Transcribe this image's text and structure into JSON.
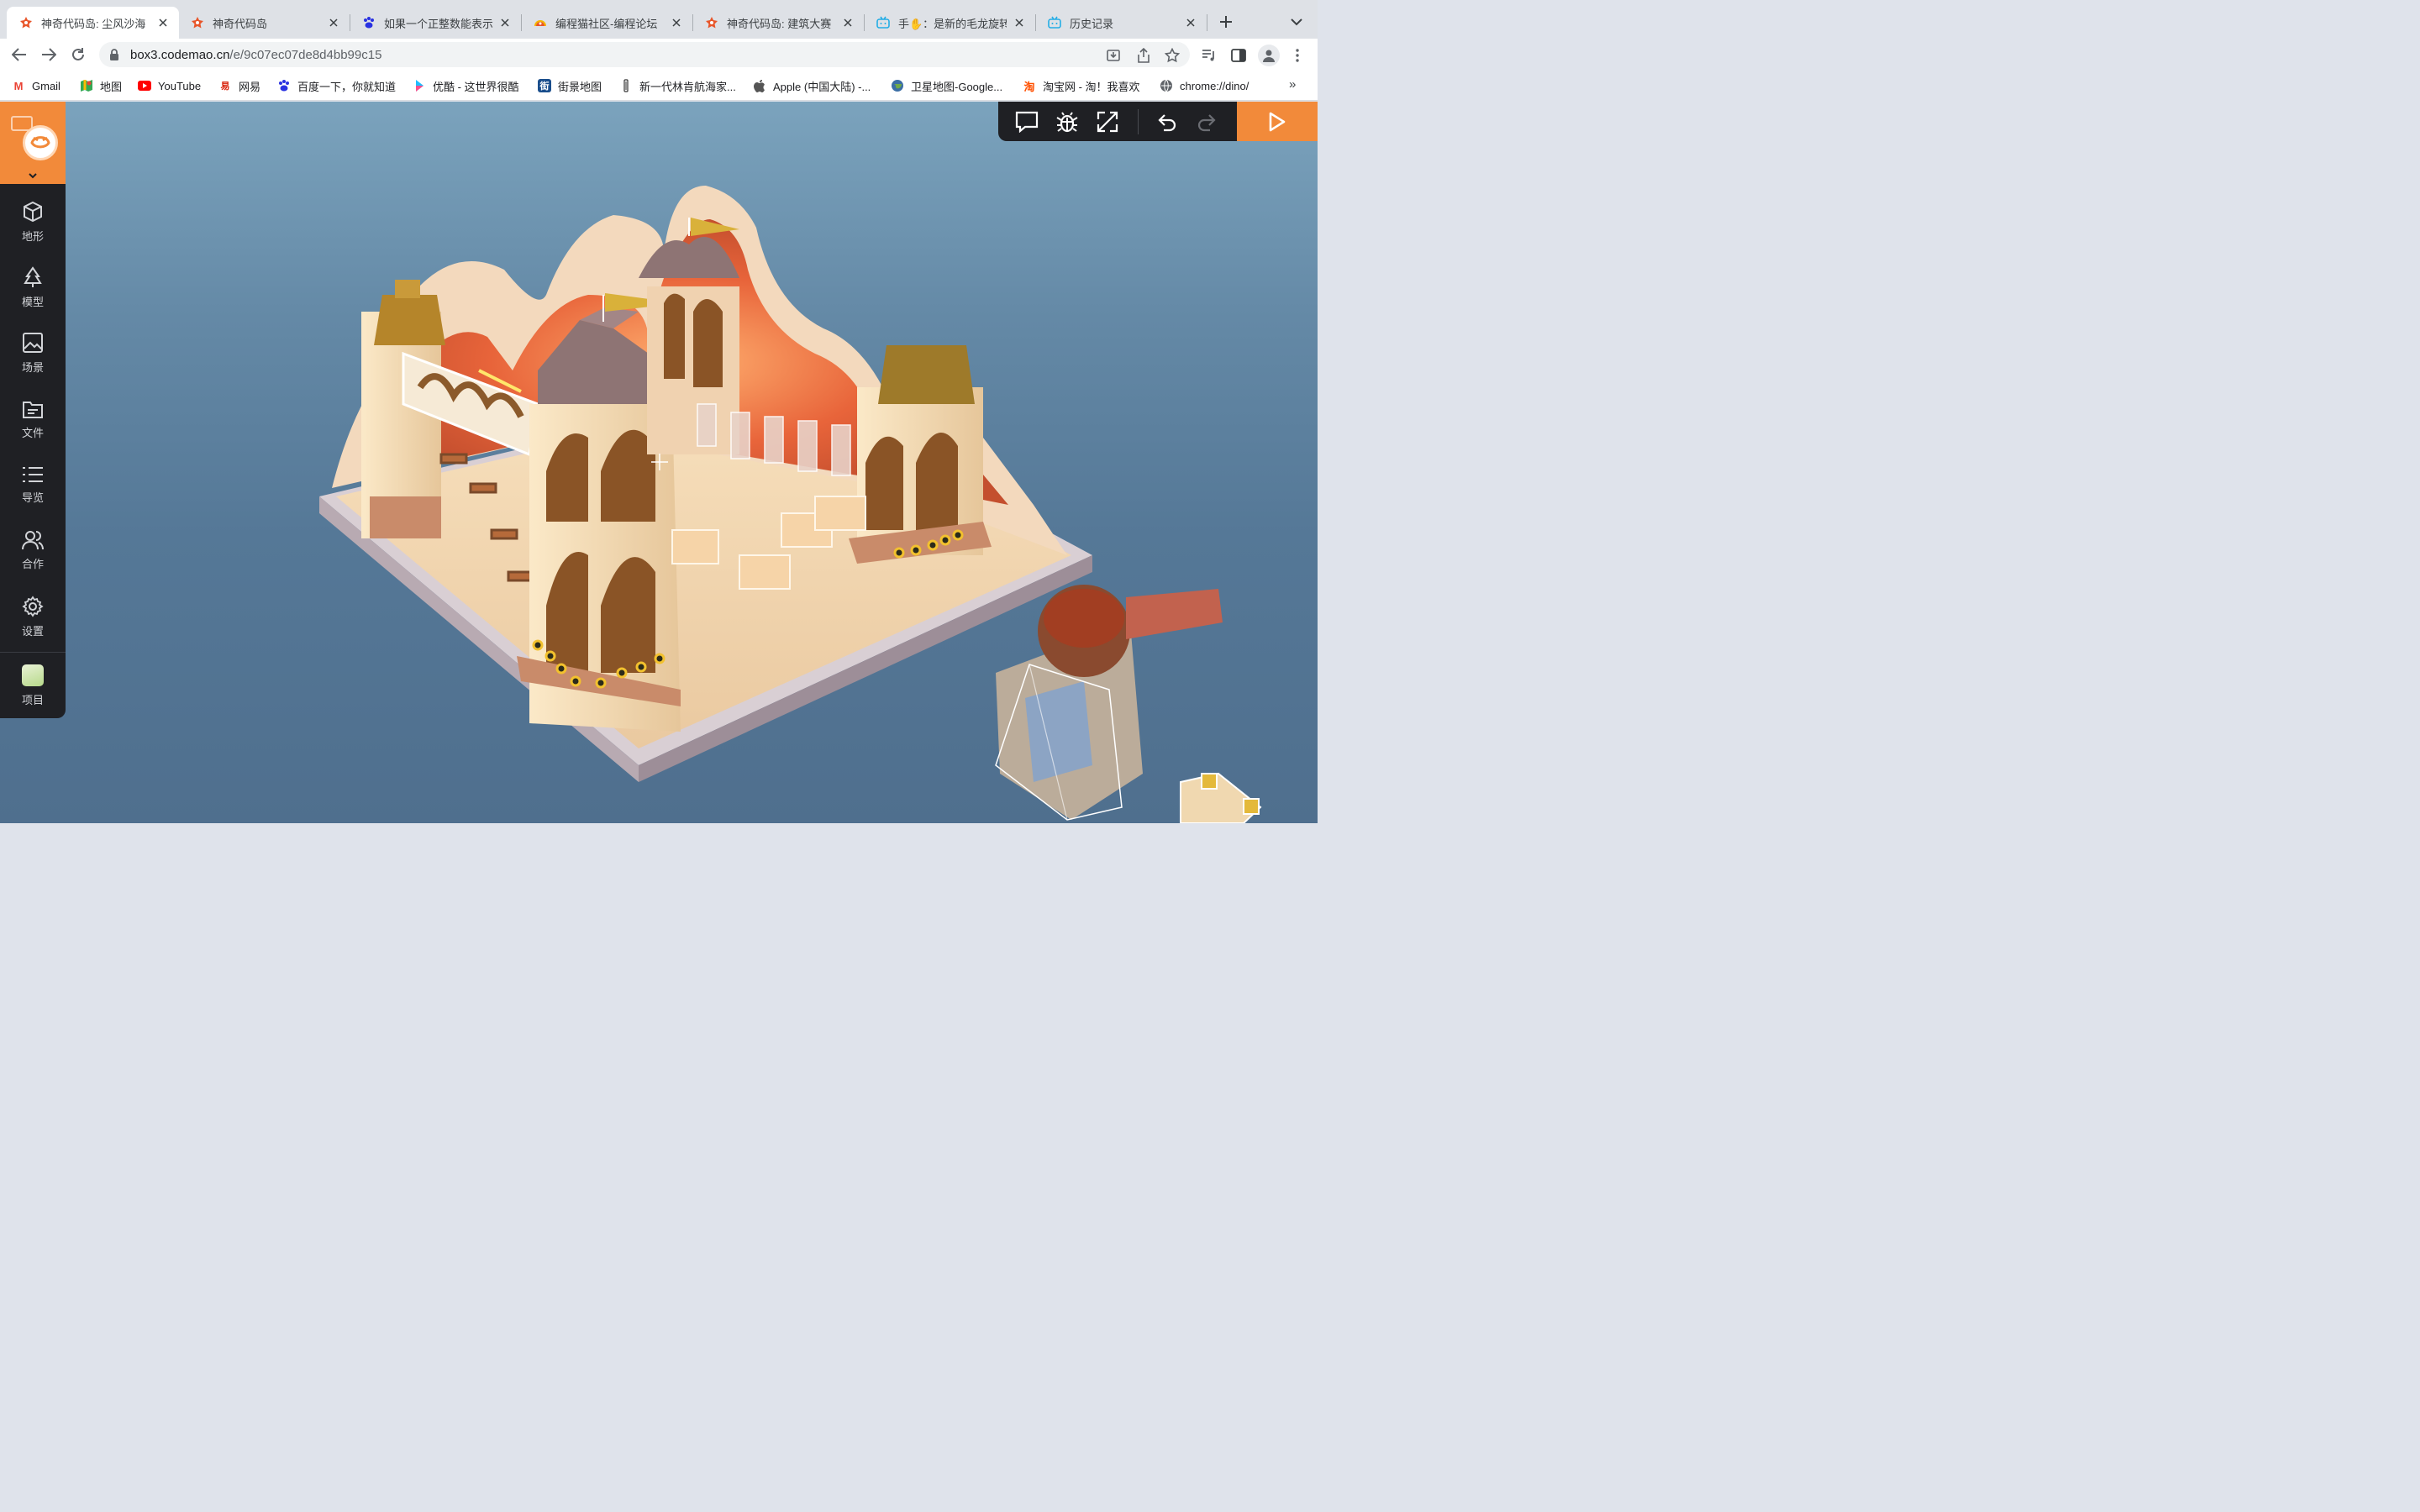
{
  "browser": {
    "tabs": [
      {
        "title": "神奇代码岛: 尘风沙海",
        "icon": "codemao-icon",
        "active": true
      },
      {
        "title": "神奇代码岛",
        "icon": "codemao-icon",
        "active": false
      },
      {
        "title": "如果一个正整数能表示",
        "icon": "baidu-icon",
        "active": false
      },
      {
        "title": "编程猫社区-编程论坛",
        "icon": "codemao-community-icon",
        "active": false
      },
      {
        "title": "神奇代码岛: 建筑大赛",
        "icon": "codemao-icon",
        "active": false
      },
      {
        "title": "手✋：是新的毛龙旋转",
        "icon": "bilibili-icon",
        "active": false
      },
      {
        "title": "历史记录",
        "icon": "history-icon",
        "active": false
      }
    ],
    "address": {
      "host": "box3.codemao.cn",
      "path": "/e/9c07ec07de8d4bb99c15"
    },
    "bookmarks": [
      {
        "label": "Gmail",
        "icon": "gmail-icon"
      },
      {
        "label": "地图",
        "icon": "maps-icon"
      },
      {
        "label": "YouTube",
        "icon": "youtube-icon"
      },
      {
        "label": "网易",
        "icon": "netease-icon"
      },
      {
        "label": "百度一下，你就知道",
        "icon": "baidu-icon"
      },
      {
        "label": "优酷 - 这世界很酷",
        "icon": "youku-icon"
      },
      {
        "label": "街景地图",
        "icon": "street-map-icon"
      },
      {
        "label": "新一代林肯航海家...",
        "icon": "lincoln-icon"
      },
      {
        "label": "Apple (中国大陆) -...",
        "icon": "apple-icon"
      },
      {
        "label": "卫星地图-Google...",
        "icon": "globe-icon"
      },
      {
        "label": "淘宝网 - 淘！我喜欢",
        "icon": "taobao-icon"
      },
      {
        "label": "chrome://dino/",
        "icon": "chrome-globe-icon"
      }
    ],
    "more_bookmarks": "»",
    "colors": {
      "tab_strip": "#dee1e6",
      "accent": "#f28a3a"
    }
  },
  "editor": {
    "sidebar": [
      {
        "label": "地形",
        "icon": "cube-icon"
      },
      {
        "label": "模型",
        "icon": "tree-icon"
      },
      {
        "label": "场景",
        "icon": "image-icon"
      },
      {
        "label": "文件",
        "icon": "folder-icon"
      },
      {
        "label": "导览",
        "icon": "list-icon"
      },
      {
        "label": "合作",
        "icon": "users-icon"
      },
      {
        "label": "设置",
        "icon": "gear-icon"
      }
    ],
    "project_label": "项目",
    "toolbar_icons": [
      "comment-icon",
      "bug-icon",
      "fullscreen-icon",
      "undo-icon",
      "redo-icon"
    ],
    "run_icon": "play-icon",
    "scene_description_colors": {
      "sky_top": "#7ba3bd",
      "sky_bottom": "#4f6f8e",
      "sand": "#f1d8b3",
      "orange_glow": "#e86a3a"
    }
  }
}
